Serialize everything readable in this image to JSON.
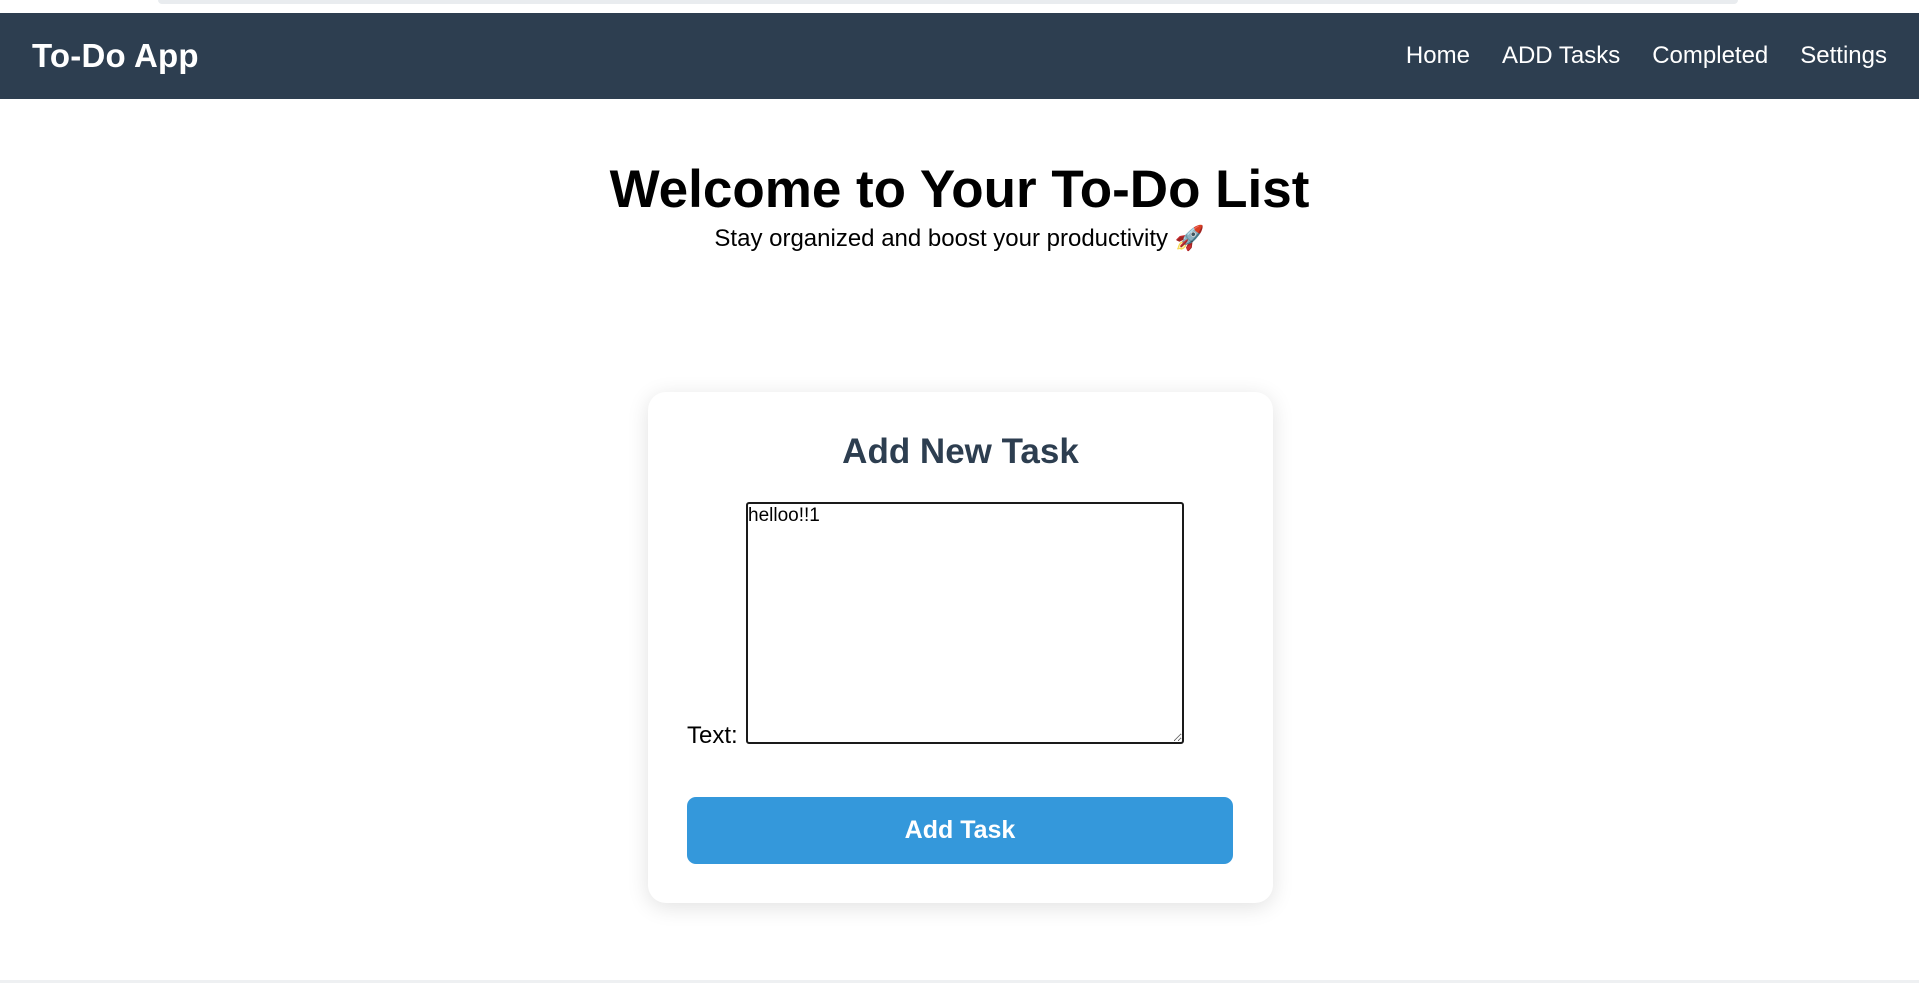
{
  "navbar": {
    "brand": "To-Do App",
    "links": [
      {
        "label": "Home"
      },
      {
        "label": "ADD Tasks"
      },
      {
        "label": "Completed"
      },
      {
        "label": "Settings"
      }
    ]
  },
  "hero": {
    "title": "Welcome to Your To-Do List",
    "subtitle": "Stay organized and boost your productivity 🚀"
  },
  "form": {
    "title": "Add New Task",
    "text_label": "Text:",
    "textarea_value": "helloo!!1",
    "submit_label": "Add Task"
  },
  "colors": {
    "navbar_bg": "#2d3e50",
    "button_bg": "#3498db",
    "card_title": "#2d3e50"
  }
}
